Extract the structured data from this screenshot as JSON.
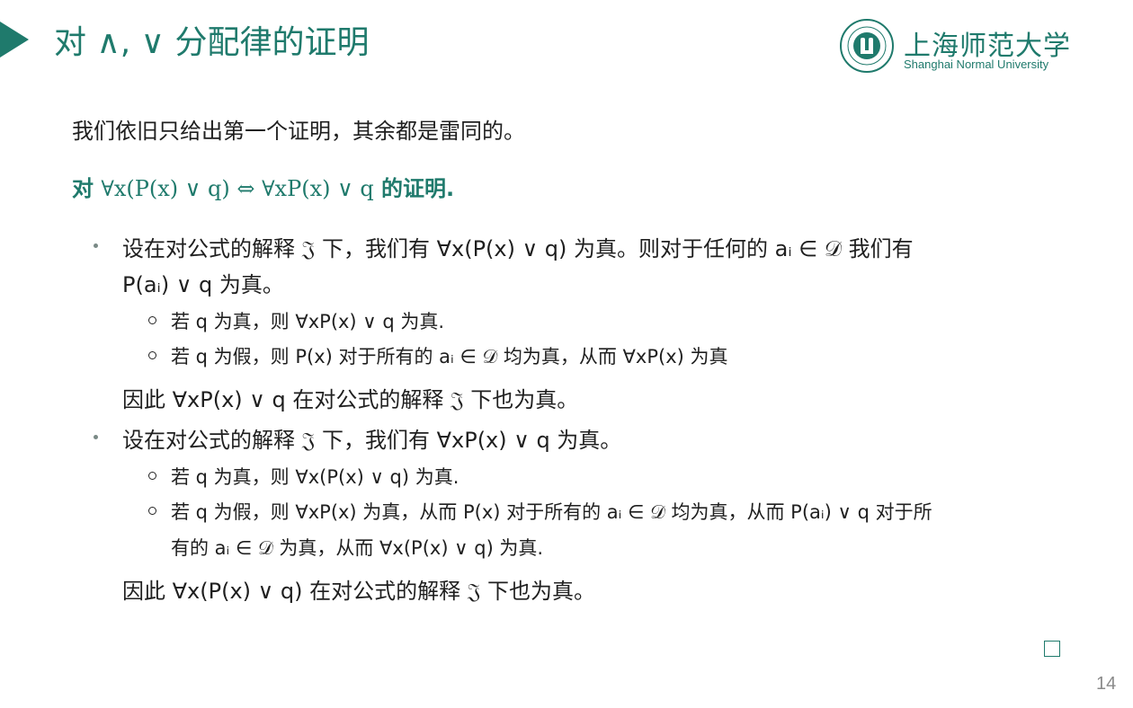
{
  "slide": {
    "title": "对 ∧, ∨ 分配律的证明",
    "page_number": "14"
  },
  "logo": {
    "name_cn": "上海师范大学",
    "name_en": "Shanghai Normal University"
  },
  "content": {
    "intro": "我们依旧只给出第一个证明，其余都是雷同的。",
    "proof_title": {
      "prefix": "对",
      "formula": "∀x(P(x) ∨ q) ⇔ ∀xP(x) ∨ q",
      "suffix": "的证明."
    },
    "part1": {
      "bullet_line1": "设在对公式的解释 𝔍 下，我们有 ∀x(P(x) ∨ q) 为真。则对于任何的 aᵢ ∈ 𝒟 我们有",
      "bullet_line2": "P(aᵢ) ∨ q 为真。",
      "sub1": "若 q 为真，则 ∀xP(x) ∨ q 为真.",
      "sub2": "若 q 为假，则 P(x) 对于所有的 aᵢ ∈ 𝒟 均为真，从而 ∀xP(x) 为真",
      "conclusion": "因此 ∀xP(x) ∨ q 在对公式的解释 𝔍 下也为真。"
    },
    "part2": {
      "bullet_line1": "设在对公式的解释 𝔍 下，我们有 ∀xP(x) ∨ q 为真。",
      "sub1": "若 q 为真，则 ∀x(P(x) ∨ q) 为真.",
      "sub2_line1": "若 q 为假，则 ∀xP(x) 为真，从而 P(x) 对于所有的 aᵢ ∈ 𝒟 均为真，从而 P(aᵢ) ∨ q 对于所",
      "sub2_line2": "有的 aᵢ ∈ 𝒟 为真，从而 ∀x(P(x) ∨ q) 为真.",
      "conclusion": "因此 ∀x(P(x) ∨ q) 在对公式的解释 𝔍 下也为真。"
    },
    "qed_symbol": "□"
  },
  "colors": {
    "accent": "#1f7a6c",
    "text": "#1f1f1f",
    "page_number": "#8a8a8a"
  }
}
